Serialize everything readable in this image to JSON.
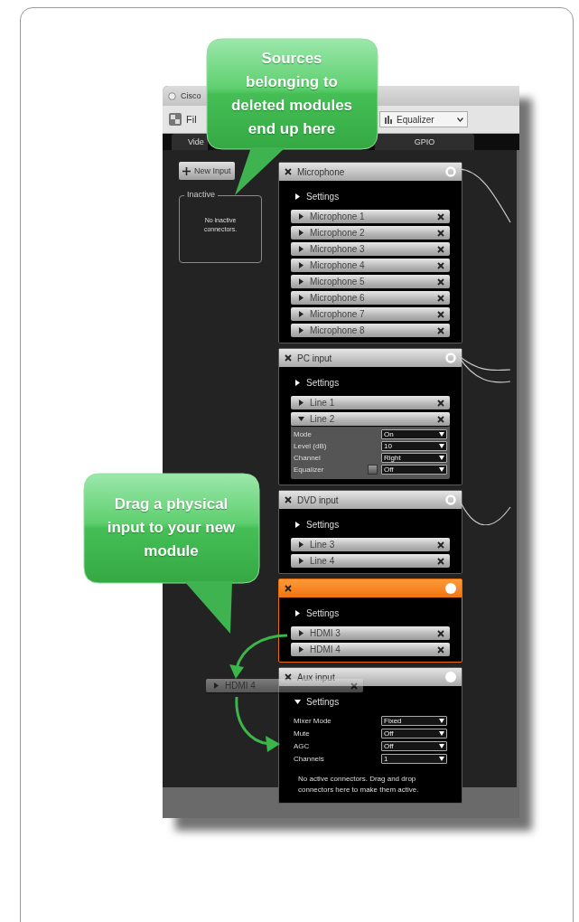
{
  "callouts": [
    {
      "text": "Sources belonging to deleted modules end up here"
    },
    {
      "text": "Drag a physical input to your new module"
    }
  ],
  "window": {
    "title": "Cisco",
    "menu": "Fil",
    "dropdown": "Equalizer",
    "tabs": [
      {
        "label": "Vide",
        "selected": false
      },
      {
        "label": "GPIO",
        "selected": false
      }
    ]
  },
  "new_input_button": "New Input",
  "inactive": {
    "title": "Inactive",
    "message": "No inactive connectors."
  },
  "modules": [
    {
      "title": "Microphone",
      "highlighted": false,
      "connected": true,
      "settings_label": "Settings",
      "settings_expanded": false,
      "connectors": [
        {
          "label": "Microphone 1",
          "expanded": false
        },
        {
          "label": "Microphone 2",
          "expanded": false
        },
        {
          "label": "Microphone 3",
          "expanded": false
        },
        {
          "label": "Microphone 4",
          "expanded": false
        },
        {
          "label": "Microphone 5",
          "expanded": false
        },
        {
          "label": "Microphone 6",
          "expanded": false
        },
        {
          "label": "Microphone 7",
          "expanded": false
        },
        {
          "label": "Microphone 8",
          "expanded": false
        }
      ]
    },
    {
      "title": "PC input",
      "highlighted": false,
      "connected": true,
      "settings_label": "Settings",
      "settings_expanded": false,
      "connectors": [
        {
          "label": "Line 1",
          "expanded": false
        },
        {
          "label": "Line 2",
          "expanded": true,
          "fields": [
            {
              "kind": "select",
              "label": "Mode",
              "value": "On"
            },
            {
              "kind": "select",
              "label": "Level (dB)",
              "value": "10"
            },
            {
              "kind": "select",
              "label": "Channel",
              "value": "Right"
            },
            {
              "kind": "select_with_button",
              "label": "Equalizer",
              "value": "Off"
            }
          ]
        }
      ]
    },
    {
      "title": "DVD input",
      "highlighted": false,
      "connected": true,
      "settings_label": "Settings",
      "settings_expanded": false,
      "connectors": [
        {
          "label": "Line 3",
          "expanded": false
        },
        {
          "label": "Line 4",
          "expanded": false
        }
      ]
    },
    {
      "highlighted": true,
      "connected": false,
      "settings_label": "Settings",
      "settings_expanded": false,
      "connectors": [
        {
          "label": "HDMI 3",
          "expanded": false
        },
        {
          "label": "HDMI 4",
          "expanded": false
        }
      ]
    },
    {
      "title": "Aux input",
      "highlighted": false,
      "connected": false,
      "settings_label": "Settings",
      "settings_expanded": true,
      "settings": [
        {
          "kind": "select",
          "label": "Mixer Mode",
          "value": "Fixed"
        },
        {
          "kind": "select",
          "label": "Mute",
          "value": "Off"
        },
        {
          "kind": "select",
          "label": "AGC",
          "value": "Off"
        },
        {
          "kind": "select",
          "label": "Channels",
          "value": "1"
        }
      ],
      "message": "No active connectors. Drag and drop connectors here to make them active."
    }
  ],
  "dragged_connector": {
    "label": "HDMI 4"
  }
}
